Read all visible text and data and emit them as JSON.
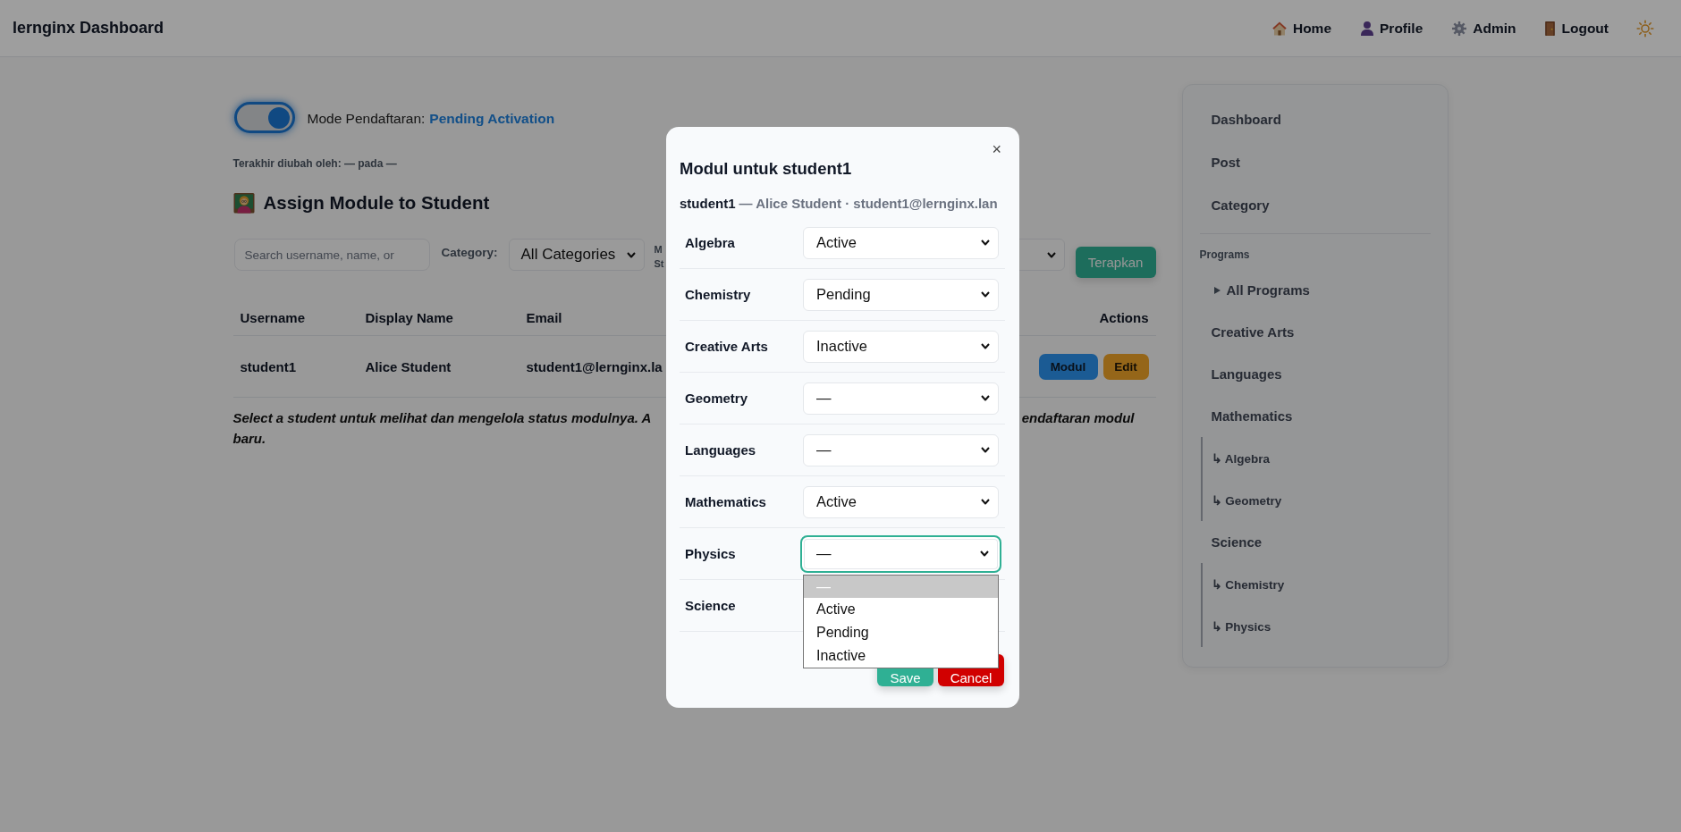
{
  "topbar": {
    "title": "lernginx Dashboard",
    "nav": [
      {
        "label": "Home",
        "kind": "home"
      },
      {
        "label": "Profile",
        "kind": "profile"
      },
      {
        "label": "Admin",
        "kind": "admin"
      },
      {
        "label": "Logout",
        "kind": "logout"
      }
    ]
  },
  "registration_mode": {
    "on": true,
    "label": "Mode Pendaftaran:",
    "value": "Pending Activation"
  },
  "last_changed": "Terakhir diubah oleh: — pada —",
  "heading": "Assign Module to Student",
  "filters": {
    "search": {
      "placeholder": "Search username, name, or"
    },
    "category_label": "Category:",
    "category_select": {
      "value": "All Categories"
    },
    "label_3": "M St",
    "apply_button": "Terapkan"
  },
  "table": {
    "columns": [
      "Username",
      "Display Name",
      "Email",
      "Actions"
    ],
    "rows": [
      {
        "cells": [
          "student1",
          "Alice Student",
          "student1@lernginx.la"
        ],
        "actions": [
          {
            "label": "Modul",
            "kind": "primary"
          },
          {
            "label": "Edit",
            "kind": "warning"
          }
        ]
      }
    ]
  },
  "note": {
    "line_1_left": "Select a student untuk melihat dan mengelola status modulnya. A",
    "line_1_right": "endaftaran modul",
    "line_2": "baru."
  },
  "sidebar": {
    "items": [
      {
        "label": "Dashboard"
      },
      {
        "label": "Post"
      },
      {
        "label": "Category"
      }
    ],
    "section": {
      "title": "Programs",
      "items": [
        {
          "label": "All Programs",
          "kind": "summary"
        },
        {
          "label": "Creative Arts",
          "kind": "link"
        },
        {
          "label": "Languages",
          "kind": "link"
        },
        {
          "label": "Mathematics",
          "kind": "link",
          "children": [
            {
              "label": "↳ Algebra"
            },
            {
              "label": "↳ Geometry"
            }
          ]
        },
        {
          "label": "Science",
          "kind": "link",
          "children": [
            {
              "label": "↳ Chemistry"
            },
            {
              "label": "↳ Physics"
            }
          ]
        }
      ]
    }
  },
  "modal": {
    "close": "×",
    "title": "Modul untuk student1",
    "username": "student1",
    "details": "— Alice Student · student1@lernginx.lan",
    "modules": [
      {
        "label": "Algebra",
        "value": "Active",
        "focused": false,
        "open": false
      },
      {
        "label": "Chemistry",
        "value": "Pending",
        "focused": false,
        "open": false
      },
      {
        "label": "Creative Arts",
        "value": "Inactive",
        "focused": false,
        "open": false
      },
      {
        "label": "Geometry",
        "value": "—",
        "focused": false,
        "open": false
      },
      {
        "label": "Languages",
        "value": "—",
        "focused": false,
        "open": false
      },
      {
        "label": "Mathematics",
        "value": "Active",
        "focused": false,
        "open": false
      },
      {
        "label": "Physics",
        "value": "—",
        "focused": true,
        "open": true,
        "options": [
          {
            "label": "—",
            "selected": true
          },
          {
            "label": "Active",
            "selected": false
          },
          {
            "label": "Pending",
            "selected": false
          },
          {
            "label": "Inactive",
            "selected": false
          }
        ]
      },
      {
        "label": "Science"
      }
    ],
    "buttons": [
      {
        "label": "Save",
        "kind": "save"
      },
      {
        "label": "Cancel",
        "kind": "cancel"
      }
    ]
  }
}
